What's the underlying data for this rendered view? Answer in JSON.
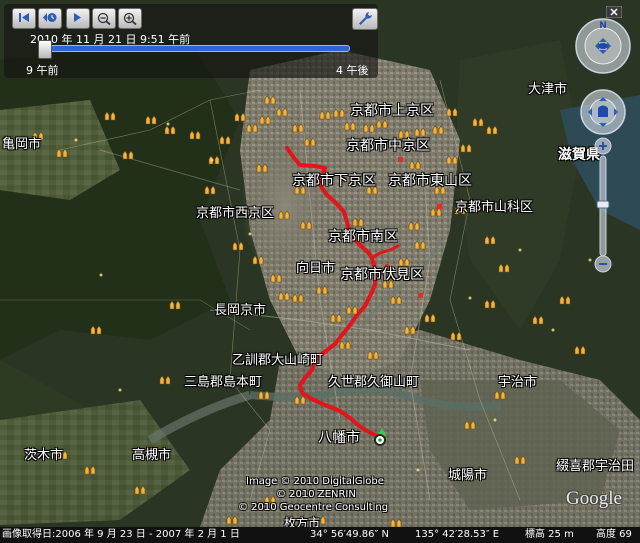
{
  "time_slider": {
    "readout": "2010 年 11 月 21 日   9:51 午前",
    "range_start": "9 午前",
    "range_end": "4 午後",
    "position": 0.02
  },
  "labels": {
    "kameoka": "亀岡市",
    "otsu": "大津市",
    "kamigyo": "京都市上京区",
    "nakagyo": "京都市中京区",
    "shimogyo": "京都市下京区",
    "higashiyama": "京都市東山区",
    "yamashina": "京都市山科区",
    "ukyo": "京都市西京区",
    "minami": "京都市南区",
    "muko": "向日市",
    "fushimi": "京都市伏見区",
    "nagaokakyo": "長岡京市",
    "oyamazaki": "乙訓郡大山崎町",
    "shimamoto": "三島郡島本町",
    "kumiyama": "久世郡久御山町",
    "uji": "宇治市",
    "yawata": "八幡市",
    "ibaraki": "茨木市",
    "takatsuki": "高槻市",
    "joyo": "城陽市",
    "ujitawara": "綴喜郡宇治田",
    "shiga": "滋賀県",
    "hirakata": "枚方市"
  },
  "credits": {
    "line1": "Image © 2010 DigitalGlobe",
    "line2": "© 2010 ZENRIN",
    "line3": "© 2010 Geocentre Consulting",
    "logo": "Google"
  },
  "status": {
    "image_date": "画像取得日:2006 年 9 月 23 日 - 2007 年 2 月 1 日",
    "lat": "34° 56′49.86″ N",
    "lon": "135° 42′28.53″ E",
    "elev": "標高  25 m",
    "eye": "高度  69"
  },
  "colors": {
    "track": "#e3141a",
    "poi": "#f5b33a",
    "slider": "#2a66d8"
  }
}
